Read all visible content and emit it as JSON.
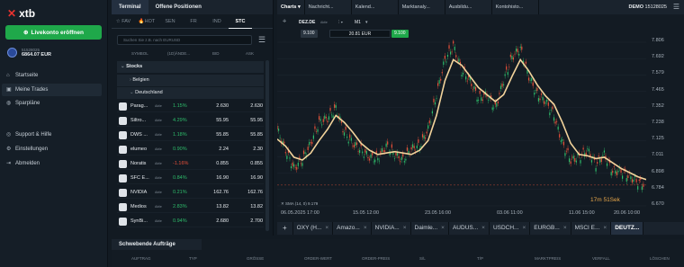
{
  "brand": {
    "name": "xtb",
    "accent": "#e8322f"
  },
  "sidebar": {
    "cta": "Livekonto eröffnen",
    "account_number": "51528025",
    "balance": "6864.07 EUR",
    "nav1": [
      {
        "label": "Startseite",
        "icon": "home-icon"
      },
      {
        "label": "Meine Trades",
        "icon": "briefcase-icon"
      },
      {
        "label": "Sparpläne",
        "icon": "piggy-icon"
      }
    ],
    "nav2": [
      {
        "label": "Support & Hilfe",
        "icon": "lifebuoy-icon"
      },
      {
        "label": "Einstellungen",
        "icon": "gear-icon"
      },
      {
        "label": "Abmelden",
        "icon": "logout-icon"
      }
    ]
  },
  "terminal": {
    "tabs": [
      "Terminal",
      "Offene Positionen"
    ],
    "market_tabs": [
      "FAV",
      "HOT",
      "SEN",
      "FR",
      "IND",
      "STC"
    ],
    "active_market_tab": "STC",
    "search_placeholder": "Suchen Sie z.B. nach EURUSD",
    "columns": [
      "SYMBOL",
      "(1D)ÄNDE...",
      "BID",
      "ASK"
    ],
    "groups": [
      "Stocks",
      "Belgien",
      "Deutschland"
    ],
    "rows": [
      {
        "name": "Parag...",
        "tag": "Aktie",
        "change": "1.15%",
        "bid": "2.630",
        "ask": "2.630",
        "dir": "pos"
      },
      {
        "name": "Siltro...",
        "tag": "Aktie",
        "change": "4.29%",
        "bid": "55.95",
        "ask": "55.95",
        "dir": "pos"
      },
      {
        "name": "DWS ...",
        "tag": "Aktie",
        "change": "1.18%",
        "bid": "55.85",
        "ask": "55.85",
        "dir": "pos"
      },
      {
        "name": "elumeo",
        "tag": "Aktie",
        "change": "0.90%",
        "bid": "2.24",
        "ask": "2.30",
        "dir": "pos"
      },
      {
        "name": "Noratis",
        "tag": "Aktie",
        "change": "-1.16%",
        "bid": "0.855",
        "ask": "0.855",
        "dir": "neg"
      },
      {
        "name": "SFC E...",
        "tag": "Aktie",
        "change": "0.84%",
        "bid": "16.90",
        "ask": "16.90",
        "dir": "pos"
      },
      {
        "name": "NVIDIA",
        "tag": "Aktie",
        "change": "0.21%",
        "bid": "162.76",
        "ask": "162.76",
        "dir": "pos"
      },
      {
        "name": "Medios",
        "tag": "Aktie",
        "change": "2.83%",
        "bid": "13.82",
        "ask": "13.82",
        "dir": "pos"
      },
      {
        "name": "SynBi...",
        "tag": "Aktie",
        "change": "0.94%",
        "bid": "2.680",
        "ask": "2.700",
        "dir": "pos"
      }
    ]
  },
  "charts": {
    "tabs": [
      "Charts",
      "Nachricht...",
      "Kalend...",
      "Marktanaly...",
      "Ausbildu...",
      "Kontohisto..."
    ],
    "demo_label": "DEMO",
    "demo_account": "15128025",
    "symbol": "DEZ.DE",
    "symbol_tag": "Aktie",
    "timeframe": "M1",
    "sell": "9.100",
    "volume": "20.81 EUR",
    "buy": "9.100",
    "indicator": "SMA (14, 0) 9.179",
    "countdown": "17m 51Sek",
    "yticks": [
      "7.806",
      "7.692",
      "7.579",
      "7.465",
      "7.352",
      "7.238",
      "7.125",
      "7.011",
      "6.898",
      "6.784",
      "6.670"
    ],
    "xticks": [
      "06.05.2025 17:00",
      "15.05 12:00",
      "23.05 16:00",
      "03.06 11:00",
      "11.06 15:00",
      "20.06 10:00"
    ],
    "bottom_tabs": [
      "OXY (H...",
      "Amazo...",
      "NVIDIA...",
      "Daimle...",
      "AUDUS...",
      "USDCH...",
      "EURGB...",
      "MSCI E...",
      "DEUTZ..."
    ],
    "active_bottom": "DEUTZ..."
  },
  "chart_data": {
    "type": "line",
    "ylim": [
      6.67,
      7.806
    ],
    "series": [
      {
        "name": "SMA (14, 0)",
        "color": "#f2d39b",
        "values": [
          7.13,
          7.08,
          7.0,
          6.98,
          7.03,
          7.12,
          7.2,
          7.3,
          7.25,
          7.18,
          7.1,
          7.05,
          7.02,
          7.03,
          7.04,
          7.03,
          7.02,
          7.05,
          7.12,
          7.3,
          7.55,
          7.7,
          7.66,
          7.58,
          7.5,
          7.45,
          7.4,
          7.45,
          7.58,
          7.7,
          7.62,
          7.52,
          7.44,
          7.38,
          7.25,
          7.1,
          7.02,
          7.01,
          6.99,
          7.0,
          6.96,
          6.92,
          6.89,
          6.86,
          6.84
        ]
      },
      {
        "name": "price",
        "color": "#d9dde2",
        "values": [
          7.2,
          7.05,
          6.92,
          6.98,
          7.1,
          7.25,
          7.28,
          7.35,
          7.18,
          7.1,
          7.05,
          7.0,
          6.99,
          7.08,
          7.02,
          6.98,
          7.06,
          7.08,
          7.2,
          7.45,
          7.7,
          7.8,
          7.62,
          7.55,
          7.42,
          7.45,
          7.35,
          7.55,
          7.72,
          7.78,
          7.58,
          7.45,
          7.4,
          7.3,
          7.1,
          6.98,
          7.0,
          7.05,
          6.95,
          7.02,
          6.9,
          6.9,
          6.86,
          6.82,
          6.8
        ]
      }
    ]
  },
  "orders": {
    "title": "Schwebende Aufträge",
    "columns": [
      "AUFTRAG",
      "TYP",
      "GRÖSSE",
      "ORDER-WERT",
      "ORDER-PREIS",
      "S/L",
      "T/P",
      "MARKTPREIS",
      "VERFALL",
      "LÖSCHEN"
    ]
  }
}
